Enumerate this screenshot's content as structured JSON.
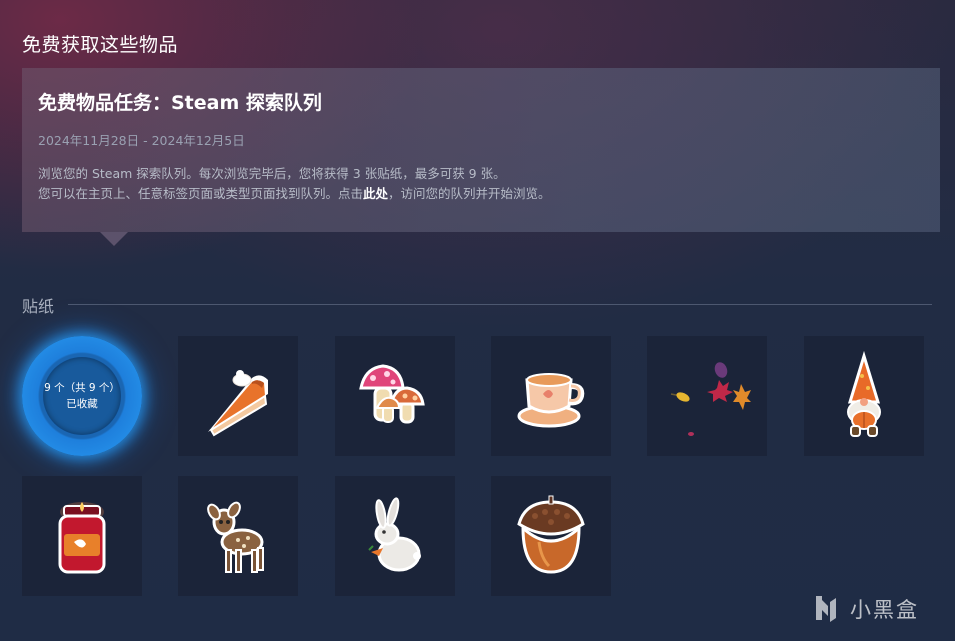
{
  "page": {
    "title": "免费获取这些物品"
  },
  "quest": {
    "title": "免费物品任务：Steam 探索队列",
    "dates": "2024年11月28日 - 2024年12月5日",
    "desc_line1": "浏览您的 Steam 探索队列。每次浏览完毕后，您将获得 3 张贴纸，最多可获 9 张。",
    "desc_line2_before": "您可以在主页上、任意标签页面或类型页面找到队列。点击",
    "desc_link": "此处",
    "desc_line2_after": "，访问您的队列并开始浏览。"
  },
  "stickers": {
    "section_label": "贴纸",
    "progress_line1": "9 个（共 9 个）",
    "progress_line2": "已收藏",
    "progress_collected": 9,
    "progress_total": 9,
    "items": [
      {
        "icon": "pumpkin-pie-slice-icon"
      },
      {
        "icon": "mushrooms-icon"
      },
      {
        "icon": "teacup-icon"
      },
      {
        "icon": "falling-leaves-icon"
      },
      {
        "icon": "gnome-with-pumpkin-icon"
      },
      {
        "icon": "candle-jar-icon"
      },
      {
        "icon": "fawn-icon"
      },
      {
        "icon": "rabbit-with-carrot-icon"
      },
      {
        "icon": "acorn-icon"
      }
    ]
  },
  "watermark": {
    "text": "小黑盒"
  },
  "colors": {
    "accent_ring": "#2a9df3",
    "tile_bg": "#1b2439",
    "panel_bg": "#5a6480"
  }
}
